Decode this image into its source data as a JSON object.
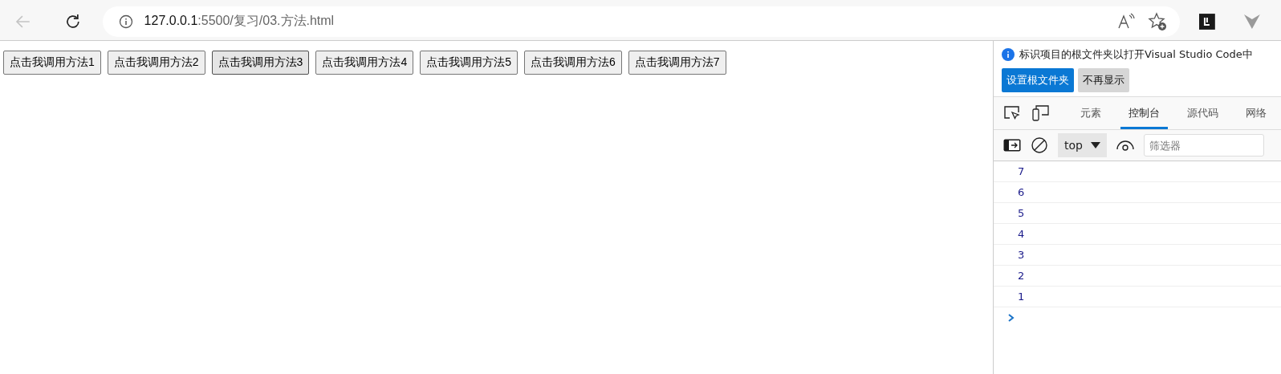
{
  "address_bar": {
    "host": "127.0.0.1",
    "path": ":5500/复习/03.方法.html"
  },
  "page": {
    "buttons": [
      {
        "label": "点击我调用方法1",
        "hovered": false
      },
      {
        "label": "点击我调用方法2",
        "hovered": false
      },
      {
        "label": "点击我调用方法3",
        "hovered": true
      },
      {
        "label": "点击我调用方法4",
        "hovered": false
      },
      {
        "label": "点击我调用方法5",
        "hovered": false
      },
      {
        "label": "点击我调用方法6",
        "hovered": false
      },
      {
        "label": "点击我调用方法7",
        "hovered": false
      }
    ]
  },
  "devtools": {
    "notice": {
      "message": "标识项目的根文件夹以打开Visual Studio Code中",
      "primary_button": "设置根文件夹",
      "secondary_button": "不再显示"
    },
    "tabs": [
      {
        "label": "元素",
        "selected": false
      },
      {
        "label": "控制台",
        "selected": true
      },
      {
        "label": "源代码",
        "selected": false
      },
      {
        "label": "网络",
        "selected": false
      }
    ],
    "context": "top",
    "filter": {
      "placeholder": "筛选器"
    },
    "console": [
      "7",
      "6",
      "5",
      "4",
      "3",
      "2",
      "1"
    ]
  }
}
